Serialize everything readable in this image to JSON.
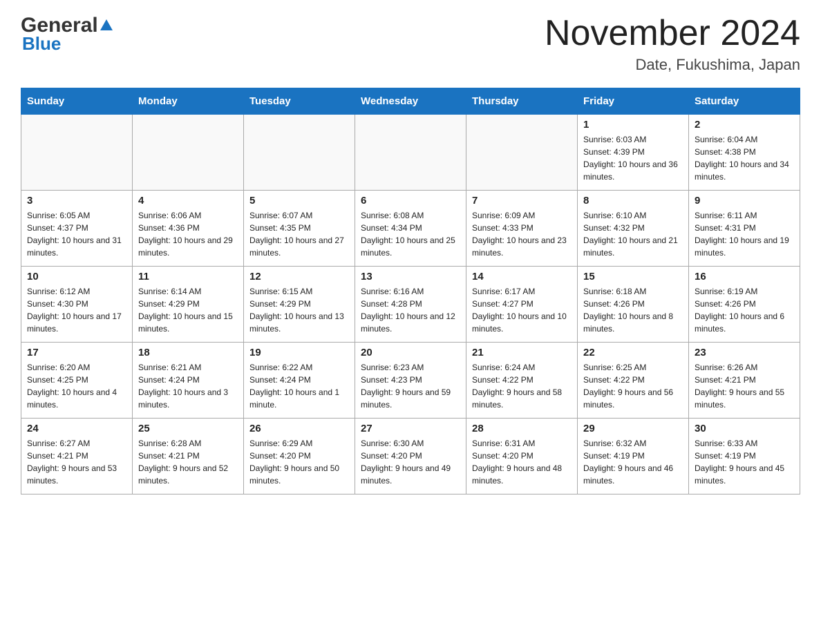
{
  "header": {
    "logo_general": "General",
    "logo_blue": "Blue",
    "title": "November 2024",
    "subtitle": "Date, Fukushima, Japan"
  },
  "calendar": {
    "days_of_week": [
      "Sunday",
      "Monday",
      "Tuesday",
      "Wednesday",
      "Thursday",
      "Friday",
      "Saturday"
    ],
    "weeks": [
      [
        {
          "day": "",
          "info": ""
        },
        {
          "day": "",
          "info": ""
        },
        {
          "day": "",
          "info": ""
        },
        {
          "day": "",
          "info": ""
        },
        {
          "day": "",
          "info": ""
        },
        {
          "day": "1",
          "info": "Sunrise: 6:03 AM\nSunset: 4:39 PM\nDaylight: 10 hours and 36 minutes."
        },
        {
          "day": "2",
          "info": "Sunrise: 6:04 AM\nSunset: 4:38 PM\nDaylight: 10 hours and 34 minutes."
        }
      ],
      [
        {
          "day": "3",
          "info": "Sunrise: 6:05 AM\nSunset: 4:37 PM\nDaylight: 10 hours and 31 minutes."
        },
        {
          "day": "4",
          "info": "Sunrise: 6:06 AM\nSunset: 4:36 PM\nDaylight: 10 hours and 29 minutes."
        },
        {
          "day": "5",
          "info": "Sunrise: 6:07 AM\nSunset: 4:35 PM\nDaylight: 10 hours and 27 minutes."
        },
        {
          "day": "6",
          "info": "Sunrise: 6:08 AM\nSunset: 4:34 PM\nDaylight: 10 hours and 25 minutes."
        },
        {
          "day": "7",
          "info": "Sunrise: 6:09 AM\nSunset: 4:33 PM\nDaylight: 10 hours and 23 minutes."
        },
        {
          "day": "8",
          "info": "Sunrise: 6:10 AM\nSunset: 4:32 PM\nDaylight: 10 hours and 21 minutes."
        },
        {
          "day": "9",
          "info": "Sunrise: 6:11 AM\nSunset: 4:31 PM\nDaylight: 10 hours and 19 minutes."
        }
      ],
      [
        {
          "day": "10",
          "info": "Sunrise: 6:12 AM\nSunset: 4:30 PM\nDaylight: 10 hours and 17 minutes."
        },
        {
          "day": "11",
          "info": "Sunrise: 6:14 AM\nSunset: 4:29 PM\nDaylight: 10 hours and 15 minutes."
        },
        {
          "day": "12",
          "info": "Sunrise: 6:15 AM\nSunset: 4:29 PM\nDaylight: 10 hours and 13 minutes."
        },
        {
          "day": "13",
          "info": "Sunrise: 6:16 AM\nSunset: 4:28 PM\nDaylight: 10 hours and 12 minutes."
        },
        {
          "day": "14",
          "info": "Sunrise: 6:17 AM\nSunset: 4:27 PM\nDaylight: 10 hours and 10 minutes."
        },
        {
          "day": "15",
          "info": "Sunrise: 6:18 AM\nSunset: 4:26 PM\nDaylight: 10 hours and 8 minutes."
        },
        {
          "day": "16",
          "info": "Sunrise: 6:19 AM\nSunset: 4:26 PM\nDaylight: 10 hours and 6 minutes."
        }
      ],
      [
        {
          "day": "17",
          "info": "Sunrise: 6:20 AM\nSunset: 4:25 PM\nDaylight: 10 hours and 4 minutes."
        },
        {
          "day": "18",
          "info": "Sunrise: 6:21 AM\nSunset: 4:24 PM\nDaylight: 10 hours and 3 minutes."
        },
        {
          "day": "19",
          "info": "Sunrise: 6:22 AM\nSunset: 4:24 PM\nDaylight: 10 hours and 1 minute."
        },
        {
          "day": "20",
          "info": "Sunrise: 6:23 AM\nSunset: 4:23 PM\nDaylight: 9 hours and 59 minutes."
        },
        {
          "day": "21",
          "info": "Sunrise: 6:24 AM\nSunset: 4:22 PM\nDaylight: 9 hours and 58 minutes."
        },
        {
          "day": "22",
          "info": "Sunrise: 6:25 AM\nSunset: 4:22 PM\nDaylight: 9 hours and 56 minutes."
        },
        {
          "day": "23",
          "info": "Sunrise: 6:26 AM\nSunset: 4:21 PM\nDaylight: 9 hours and 55 minutes."
        }
      ],
      [
        {
          "day": "24",
          "info": "Sunrise: 6:27 AM\nSunset: 4:21 PM\nDaylight: 9 hours and 53 minutes."
        },
        {
          "day": "25",
          "info": "Sunrise: 6:28 AM\nSunset: 4:21 PM\nDaylight: 9 hours and 52 minutes."
        },
        {
          "day": "26",
          "info": "Sunrise: 6:29 AM\nSunset: 4:20 PM\nDaylight: 9 hours and 50 minutes."
        },
        {
          "day": "27",
          "info": "Sunrise: 6:30 AM\nSunset: 4:20 PM\nDaylight: 9 hours and 49 minutes."
        },
        {
          "day": "28",
          "info": "Sunrise: 6:31 AM\nSunset: 4:20 PM\nDaylight: 9 hours and 48 minutes."
        },
        {
          "day": "29",
          "info": "Sunrise: 6:32 AM\nSunset: 4:19 PM\nDaylight: 9 hours and 46 minutes."
        },
        {
          "day": "30",
          "info": "Sunrise: 6:33 AM\nSunset: 4:19 PM\nDaylight: 9 hours and 45 minutes."
        }
      ]
    ]
  }
}
